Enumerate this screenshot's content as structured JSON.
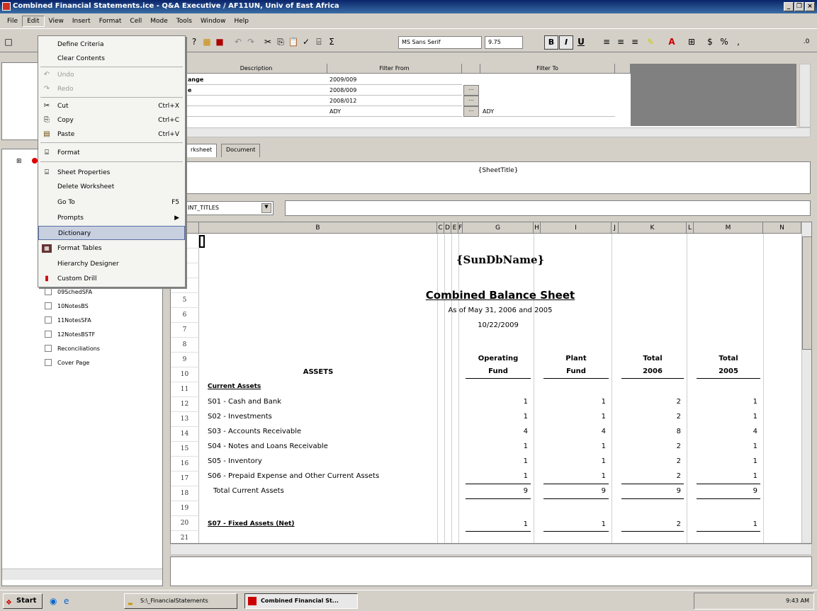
{
  "window": {
    "title": "Combined Financial Statements.ice - Q&A Executive / AF11UN, Univ of East Africa"
  },
  "menubar": [
    "File",
    "Edit",
    "View",
    "Insert",
    "Format",
    "Cell",
    "Mode",
    "Tools",
    "Window",
    "Help"
  ],
  "toolbar": {
    "font_name": "MS Sans Serif",
    "font_size": "9.75",
    "bold": "B",
    "italic": "I",
    "underline": "U"
  },
  "filter": {
    "headers": [
      "Description",
      "Filter From",
      "Filter To"
    ],
    "rows": [
      {
        "desc": "ange",
        "from": "2009/009",
        "to": ""
      },
      {
        "desc": "e",
        "from": "2008/009",
        "to": ""
      },
      {
        "desc": "",
        "from": "2008/012",
        "to": ""
      },
      {
        "desc": "",
        "from": "ADY",
        "to": "ADY"
      }
    ]
  },
  "tabs": [
    "rksheet",
    "Document"
  ],
  "sheet_title": "{SheetTitle}",
  "name_box": "INT_TITLES",
  "columns": [
    "",
    "B",
    "C",
    "D",
    "E",
    "F",
    "G",
    "H",
    "I",
    "J",
    "K",
    "L",
    "M",
    "N"
  ],
  "sheet": {
    "db_name": "{SunDbName}",
    "title": "Combined Balance Sheet",
    "subtitle": "As of May 31, 2006 and 2005",
    "date": "10/22/2009",
    "col_headers": [
      {
        "l1": "Operating",
        "l2": "Fund"
      },
      {
        "l1": "Plant",
        "l2": "Fund"
      },
      {
        "l1": "Total",
        "l2": "2006"
      },
      {
        "l1": "Total",
        "l2": "2005"
      }
    ],
    "assets_label": "ASSETS",
    "current_assets_label": "Current Assets",
    "rows": [
      {
        "n": "12",
        "label": "S01 - Cash and Bank",
        "v": [
          "1",
          "1",
          "2",
          "1"
        ]
      },
      {
        "n": "13",
        "label": "S02 - Investments",
        "v": [
          "1",
          "1",
          "2",
          "1"
        ]
      },
      {
        "n": "14",
        "label": "S03 - Accounts Receivable",
        "v": [
          "4",
          "4",
          "8",
          "4"
        ]
      },
      {
        "n": "15",
        "label": "S04 - Notes and Loans Receivable",
        "v": [
          "1",
          "1",
          "2",
          "1"
        ]
      },
      {
        "n": "16",
        "label": "S05 - Inventory",
        "v": [
          "1",
          "1",
          "2",
          "1"
        ]
      },
      {
        "n": "17",
        "label": "S06 - Prepaid Expense and Other Current Assets",
        "v": [
          "1",
          "1",
          "2",
          "1"
        ]
      },
      {
        "n": "18",
        "label": "Total Current Assets",
        "v": [
          "9",
          "9",
          "9",
          "9"
        ]
      }
    ],
    "fixed": {
      "label": "S07 - Fixed Assets (Net)",
      "v": [
        "1",
        "1",
        "2",
        "1"
      ]
    },
    "row_numbers": [
      "",
      "",
      "",
      "",
      "5",
      "6",
      "7",
      "8",
      "9",
      "10",
      "11",
      "12",
      "13",
      "14",
      "15",
      "16",
      "17",
      "18",
      "19",
      "20",
      "21"
    ]
  },
  "tree": [
    "09SchedSFA",
    "10NotesBS",
    "11NotesSFA",
    "12NotesBSTF",
    "Reconciliations",
    "Cover Page"
  ],
  "edit_menu": [
    {
      "label": "Define Criteria",
      "shortcut": "",
      "disabled": false
    },
    {
      "label": "Clear Contents",
      "shortcut": "",
      "disabled": false
    },
    {
      "label": "Undo",
      "shortcut": "",
      "disabled": true
    },
    {
      "label": "Redo",
      "shortcut": "",
      "disabled": true
    },
    {
      "label": "Cut",
      "shortcut": "Ctrl+X",
      "disabled": false
    },
    {
      "label": "Copy",
      "shortcut": "Ctrl+C",
      "disabled": false
    },
    {
      "label": "Paste",
      "shortcut": "Ctrl+V",
      "disabled": false
    },
    {
      "label": "Format",
      "shortcut": "",
      "disabled": false
    },
    {
      "label": "Sheet Properties",
      "shortcut": "",
      "disabled": false
    },
    {
      "label": "Delete Worksheet",
      "shortcut": "",
      "disabled": false
    },
    {
      "label": "Go To",
      "shortcut": "F5",
      "disabled": false
    },
    {
      "label": "Prompts",
      "shortcut": "",
      "disabled": false
    },
    {
      "label": "Dictionary",
      "shortcut": "",
      "disabled": false
    },
    {
      "label": "Format Tables",
      "shortcut": "",
      "disabled": false
    },
    {
      "label": "Hierarchy Designer",
      "shortcut": "",
      "disabled": false
    },
    {
      "label": "Custom Drill",
      "shortcut": "",
      "disabled": false
    }
  ],
  "taskbar": {
    "start": "Start",
    "items": [
      "S:\\_FinancialStatements",
      "Combined Financial St..."
    ],
    "clock": "9:43 AM"
  }
}
